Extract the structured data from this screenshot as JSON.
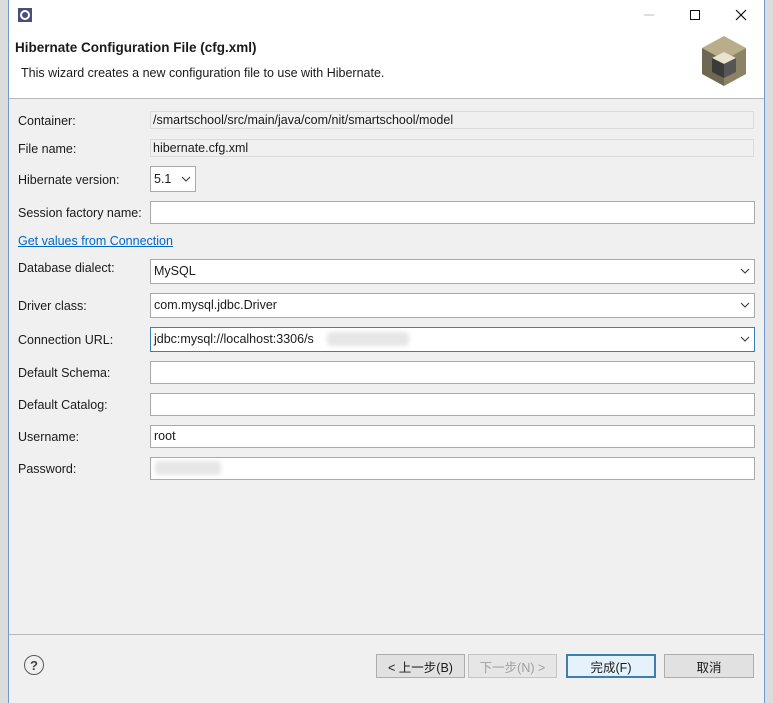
{
  "window": {
    "header_title": "Hibernate Configuration File (cfg.xml)",
    "header_desc": "This wizard creates a new configuration file to use with Hibernate."
  },
  "form": {
    "container_label": "Container:",
    "container_value": "/smartschool/src/main/java/com/nit/smartschool/model",
    "filename_label": "File name:",
    "filename_value": "hibernate.cfg.xml",
    "version_label": "Hibernate version:",
    "version_value": "5.1",
    "session_factory_label": "Session factory name:",
    "session_factory_value": "",
    "get_values_link": "Get values from Connection",
    "dialect_label": "Database dialect:",
    "dialect_value": "MySQL",
    "driver_label": "Driver class:",
    "driver_value": "com.mysql.jdbc.Driver",
    "url_label": "Connection URL:",
    "url_value": "jdbc:mysql://localhost:3306/s",
    "schema_label": "Default Schema:",
    "schema_value": "",
    "catalog_label": "Default Catalog:",
    "catalog_value": "",
    "username_label": "Username:",
    "username_value": "root",
    "password_label": "Password:"
  },
  "buttons": {
    "help": "?",
    "back": "< 上一步(B)",
    "next": "下一步(N) >",
    "finish": "完成(F)",
    "cancel": "取消"
  }
}
